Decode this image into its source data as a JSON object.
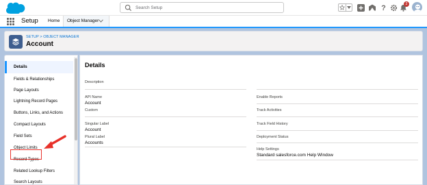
{
  "colors": {
    "accent": "#1b96ff",
    "link": "#0070d2",
    "header_bg": "#b0c4df",
    "object_icon": "#3e5e8f",
    "annotation_red": "#e8312a",
    "notification_red": "#c23934"
  },
  "header": {
    "logo_icon": "salesforce-cloud-logo",
    "search": {
      "placeholder": "Search Setup",
      "value": ""
    },
    "icons": [
      "star-icon",
      "chevron-down-icon",
      "add-icon",
      "trailhead-icon",
      "help-icon",
      "gear-icon",
      "bell-icon",
      "avatar"
    ],
    "notification_count": "2"
  },
  "app_nav": {
    "app_name": "Setup",
    "tabs": [
      {
        "label": "Home"
      },
      {
        "label": "Object Manager",
        "active": true
      }
    ]
  },
  "page_header": {
    "breadcrumb": "SETUP > OBJECT MANAGER",
    "title": "Account",
    "icon": "layers-icon"
  },
  "sidebar": {
    "items": [
      {
        "label": "Details",
        "active": true
      },
      {
        "label": "Fields & Relationships"
      },
      {
        "label": "Page Layouts"
      },
      {
        "label": "Lightning Record Pages"
      },
      {
        "label": "Buttons, Links, and Actions"
      },
      {
        "label": "Compact Layouts"
      },
      {
        "label": "Field Sets"
      },
      {
        "label": "Object Limits"
      },
      {
        "label": "Record Types",
        "highlighted": true
      },
      {
        "label": "Related Lookup Filters"
      },
      {
        "label": "Search Layouts"
      }
    ]
  },
  "details": {
    "title": "Details",
    "description_label": "Description",
    "left_fields": [
      {
        "label": "API Name",
        "value": "Account"
      },
      {
        "label": "Custom",
        "value": ""
      },
      {
        "label": "Singular Label",
        "value": "Account"
      },
      {
        "label": "Plural Label",
        "value": "Accounts"
      }
    ],
    "right_fields": [
      {
        "label": "Enable Reports",
        "value": ""
      },
      {
        "label": "Track Activities",
        "value": ""
      },
      {
        "label": "Track Field History",
        "value": ""
      },
      {
        "label": "Deployment Status",
        "value": ""
      },
      {
        "label": "Help Settings",
        "value": "Standard salesforce.com Help Window"
      }
    ]
  }
}
